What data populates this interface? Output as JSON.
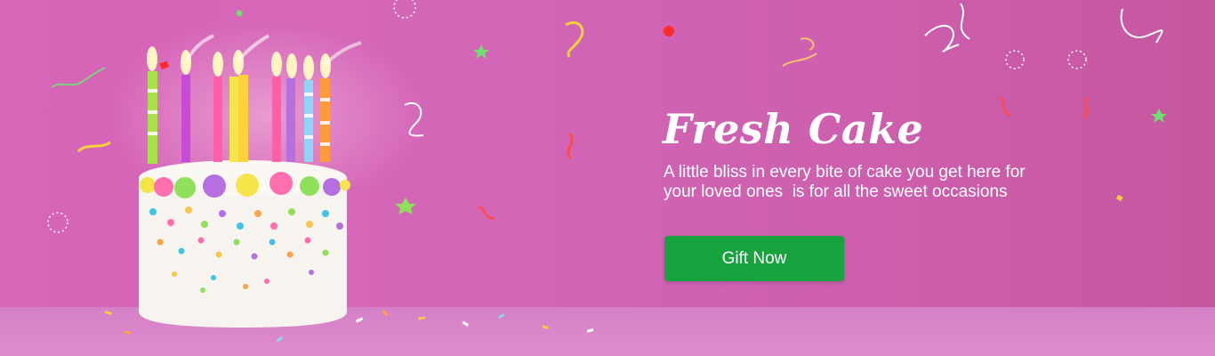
{
  "banner": {
    "headline": "Fresh Cake",
    "description_lines": [
      "A little bliss in every bite of cake you get here for",
      "your loved ones  is for all the sweet occasions"
    ],
    "cta_label": "Gift Now",
    "image_subject": "birthday-cake-with-candles",
    "colors": {
      "background": "#d466b8",
      "button": "#17a43f",
      "text": "#ffffff"
    }
  }
}
